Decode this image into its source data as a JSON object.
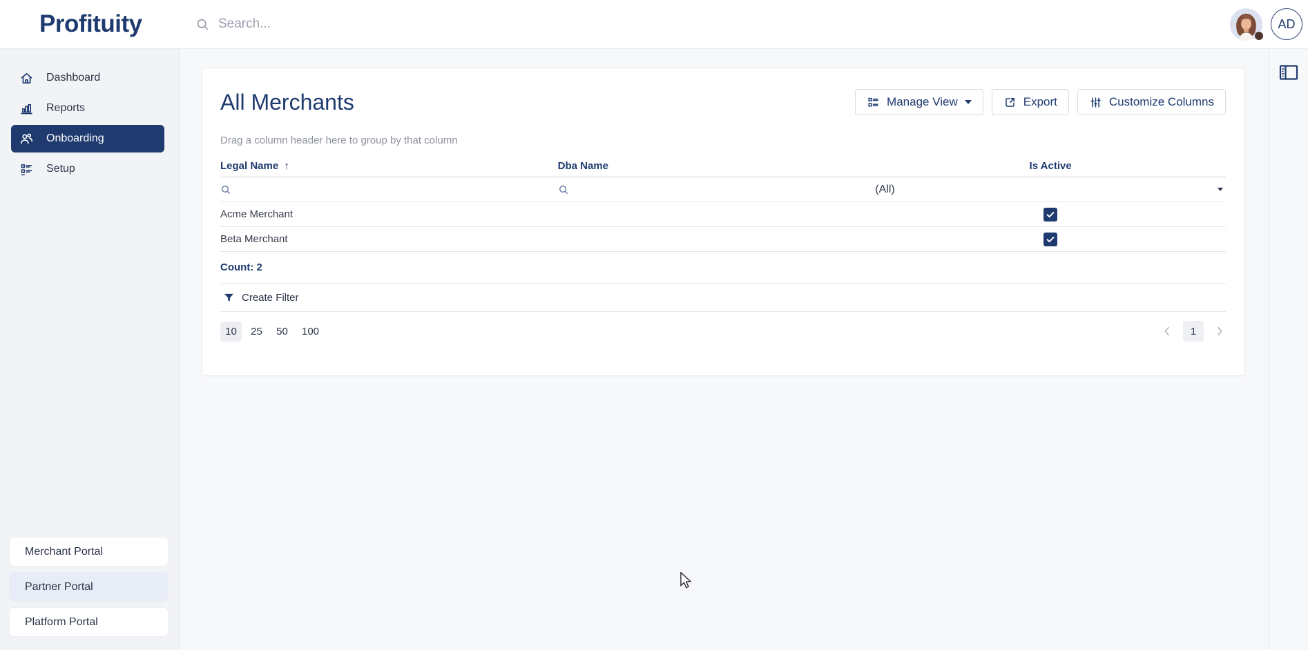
{
  "colors": {
    "primary": "#1e3a6e",
    "sidebar_bg": "#f2f3f6",
    "main_bg": "#f7f8fa",
    "portal_highlight": "#e8ecf6",
    "checkbox": "#1e3a6e"
  },
  "header": {
    "logo_text": "Profituity",
    "search_placeholder": "Search...",
    "avatar_initials": "AD"
  },
  "sidebar": {
    "items": [
      {
        "label": "Dashboard",
        "icon": "home-icon",
        "active": false
      },
      {
        "label": "Reports",
        "icon": "bar-chart-icon",
        "active": false
      },
      {
        "label": "Onboarding",
        "icon": "users-icon",
        "active": true
      },
      {
        "label": "Setup",
        "icon": "list-icon",
        "active": false
      }
    ],
    "portals": [
      {
        "label": "Merchant Portal",
        "highlighted": false
      },
      {
        "label": "Partner Portal",
        "highlighted": true
      },
      {
        "label": "Platform Portal",
        "highlighted": false
      }
    ]
  },
  "main": {
    "title": "All Merchants",
    "toolbar": {
      "manage_view_label": "Manage View",
      "export_label": "Export",
      "customize_columns_label": "Customize Columns"
    },
    "group_hint": "Drag a column header here to group by that column",
    "table": {
      "columns": [
        {
          "label": "Legal Name",
          "sorted": "ascending"
        },
        {
          "label": "Dba Name",
          "sorted": null
        },
        {
          "label": "Is Active",
          "sorted": null
        }
      ],
      "sort_arrow": "↑",
      "filters": {
        "is_active_filter_value": "(All)"
      },
      "rows": [
        {
          "legal_name": "Acme Merchant",
          "dba_name": "",
          "is_active": true
        },
        {
          "legal_name": "Beta Merchant",
          "dba_name": "",
          "is_active": true
        }
      ],
      "summary": "Count: 2",
      "create_filter_label": "Create Filter"
    },
    "pagination": {
      "page_sizes": [
        "10",
        "25",
        "50",
        "100"
      ],
      "selected_size": "10",
      "current_page": "1"
    }
  }
}
